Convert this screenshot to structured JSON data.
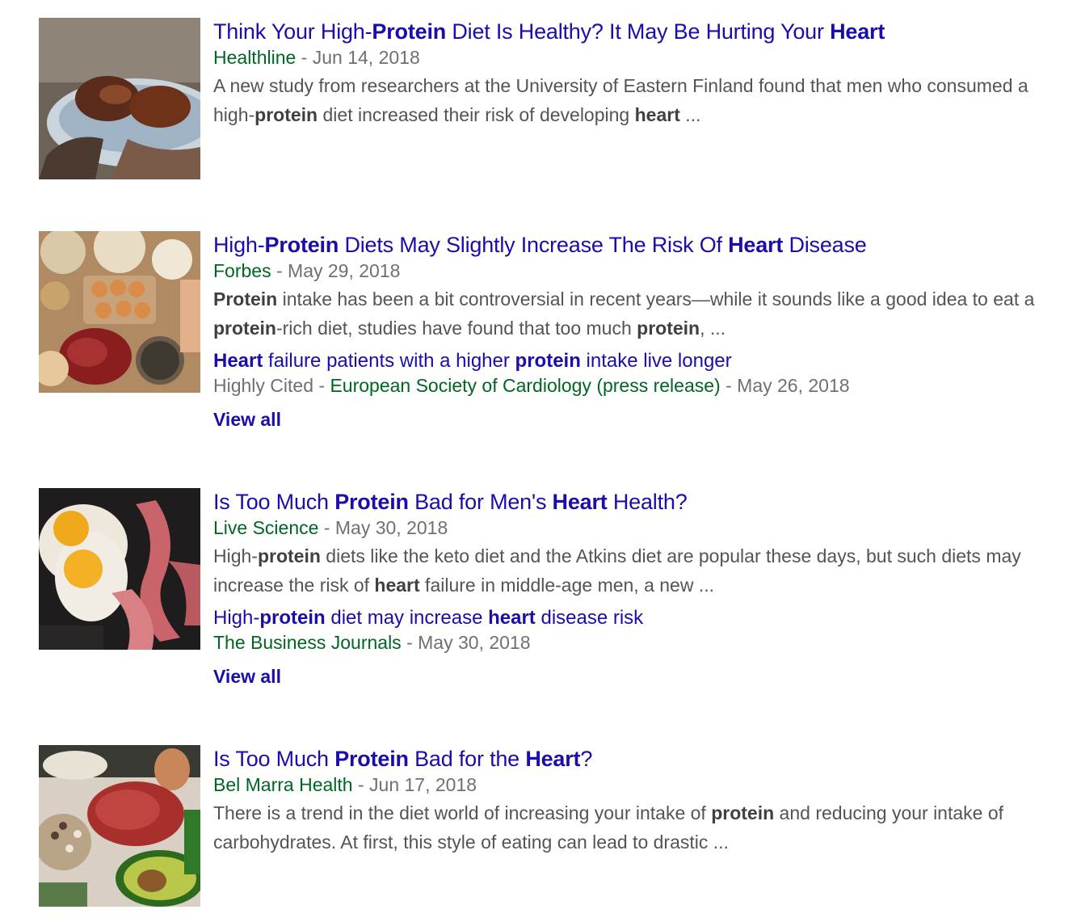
{
  "results": [
    {
      "title": [
        {
          "t": "Think Your High-",
          "b": false
        },
        {
          "t": "Protein",
          "b": true
        },
        {
          "t": " Diet Is Healthy? It May Be Hurting Your ",
          "b": false
        },
        {
          "t": "Heart",
          "b": true
        }
      ],
      "source": "Healthline",
      "date": "Jun 14, 2018",
      "snippet": [
        {
          "t": "A new study from researchers at the University of Eastern Finland found that men who consumed a high-",
          "b": false
        },
        {
          "t": "protein",
          "b": true
        },
        {
          "t": " diet increased their risk of developing ",
          "b": false
        },
        {
          "t": "heart",
          "b": true
        },
        {
          "t": " ...",
          "b": false
        }
      ],
      "thumbnail": "plate-of-grilled-meat-image"
    },
    {
      "title": [
        {
          "t": "High-",
          "b": false
        },
        {
          "t": "Protein",
          "b": true
        },
        {
          "t": " Diets May Slightly Increase The Risk Of ",
          "b": false
        },
        {
          "t": "Heart",
          "b": true
        },
        {
          "t": " Disease",
          "b": false
        }
      ],
      "source": "Forbes",
      "date": "May 29, 2018",
      "snippet": [
        {
          "t": "Protein",
          "b": true
        },
        {
          "t": " intake has been a bit controversial in recent years—while it sounds like a good idea to eat a ",
          "b": false
        },
        {
          "t": "protein",
          "b": true
        },
        {
          "t": "-rich diet, studies have found that too much ",
          "b": false
        },
        {
          "t": "protein",
          "b": true
        },
        {
          "t": ", ...",
          "b": false
        }
      ],
      "sub": {
        "title": [
          {
            "t": "Heart",
            "b": true
          },
          {
            "t": " failure patients with a higher ",
            "b": false
          },
          {
            "t": "protein",
            "b": true
          },
          {
            "t": " intake live longer",
            "b": false
          }
        ],
        "label": "Highly Cited",
        "source": "European Society of Cardiology (press release)",
        "date": "May 26, 2018"
      },
      "view_all": "View all",
      "thumbnail": "eggs-and-grains-image"
    },
    {
      "title": [
        {
          "t": "Is Too Much ",
          "b": false
        },
        {
          "t": "Protein",
          "b": true
        },
        {
          "t": " Bad for Men's ",
          "b": false
        },
        {
          "t": "Heart",
          "b": true
        },
        {
          "t": " Health?",
          "b": false
        }
      ],
      "source": "Live Science",
      "date": "May 30, 2018",
      "snippet": [
        {
          "t": "High-",
          "b": false
        },
        {
          "t": "protein",
          "b": true
        },
        {
          "t": " diets like the keto diet and the Atkins diet are popular these days, but such diets may increase the risk of ",
          "b": false
        },
        {
          "t": "heart",
          "b": true
        },
        {
          "t": " failure in middle-age men, a new ...",
          "b": false
        }
      ],
      "sub": {
        "title": [
          {
            "t": "High-",
            "b": false
          },
          {
            "t": "protein",
            "b": true
          },
          {
            "t": " diet may increase ",
            "b": false
          },
          {
            "t": "heart",
            "b": true
          },
          {
            "t": " disease risk",
            "b": false
          }
        ],
        "label": "",
        "source": "The Business Journals",
        "date": "May 30, 2018"
      },
      "view_all": "View all",
      "thumbnail": "fried-eggs-and-bacon-image"
    },
    {
      "title": [
        {
          "t": "Is Too Much ",
          "b": false
        },
        {
          "t": "Protein",
          "b": true
        },
        {
          "t": " Bad for the ",
          "b": false
        },
        {
          "t": "Heart",
          "b": true
        },
        {
          "t": "?",
          "b": false
        }
      ],
      "source": "Bel Marra Health",
      "date": "Jun 17, 2018",
      "snippet": [
        {
          "t": "There is a trend in the diet world of increasing your intake of ",
          "b": false
        },
        {
          "t": "protein",
          "b": true
        },
        {
          "t": " and reducing your intake of carbohydrates. At first, this style of eating can lead to drastic ...",
          "b": false
        }
      ],
      "thumbnail": "steak-avocado-beans-image"
    }
  ],
  "meta_separator": " - "
}
